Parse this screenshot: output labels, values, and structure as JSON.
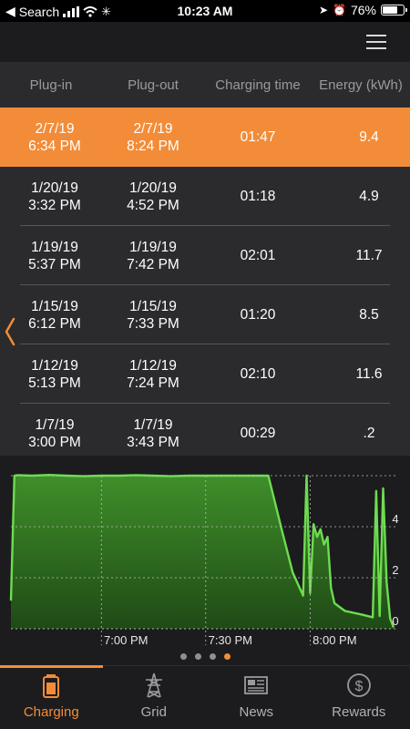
{
  "status_bar": {
    "carrier": "Search",
    "time": "10:23 AM",
    "battery": "76%",
    "battery_level": 0.76
  },
  "table": {
    "headers": [
      "Plug-in",
      "Plug-out",
      "Charging time",
      "Energy (kWh)"
    ],
    "rows": [
      {
        "plug_in_date": "2/7/19",
        "plug_in_time": "6:34 PM",
        "plug_out_date": "2/7/19",
        "plug_out_time": "8:24 PM",
        "charging_time": "01:47",
        "energy": "9.4",
        "selected": true
      },
      {
        "plug_in_date": "1/20/19",
        "plug_in_time": "3:32 PM",
        "plug_out_date": "1/20/19",
        "plug_out_time": "4:52 PM",
        "charging_time": "01:18",
        "energy": "4.9"
      },
      {
        "plug_in_date": "1/19/19",
        "plug_in_time": "5:37 PM",
        "plug_out_date": "1/19/19",
        "plug_out_time": "7:42 PM",
        "charging_time": "02:01",
        "energy": "11.7"
      },
      {
        "plug_in_date": "1/15/19",
        "plug_in_time": "6:12 PM",
        "plug_out_date": "1/15/19",
        "plug_out_time": "7:33 PM",
        "charging_time": "01:20",
        "energy": "8.5"
      },
      {
        "plug_in_date": "1/12/19",
        "plug_in_time": "5:13 PM",
        "plug_out_date": "1/12/19",
        "plug_out_time": "7:24 PM",
        "charging_time": "02:10",
        "energy": "11.6"
      },
      {
        "plug_in_date": "1/7/19",
        "plug_in_time": "3:00 PM",
        "plug_out_date": "1/7/19",
        "plug_out_time": "3:43 PM",
        "charging_time": "00:29",
        "energy": ".2"
      }
    ]
  },
  "chart_data": {
    "type": "area",
    "title": "",
    "xlabel": "",
    "ylabel": "",
    "x_ticks": [
      "7:00 PM",
      "7:30 PM",
      "8:00 PM"
    ],
    "y_ticks": [
      "0",
      "2",
      "4"
    ],
    "ylim": [
      0,
      6
    ],
    "grid": true,
    "color": "#6ddc4f",
    "series": [
      {
        "x": [
          "6:34 PM",
          "6:35 PM",
          "6:36 PM",
          "6:40 PM",
          "6:45 PM",
          "6:50 PM",
          "6:55 PM",
          "7:00 PM",
          "7:05 PM",
          "7:10 PM",
          "7:15 PM",
          "7:20 PM",
          "7:25 PM",
          "7:30 PM",
          "7:35 PM",
          "7:40 PM",
          "7:45 PM",
          "7:48 PM",
          "7:52 PM",
          "7:55 PM",
          "7:57 PM",
          "7:58 PM",
          "7:59 PM",
          "8:00 PM",
          "8:01 PM",
          "8:02 PM",
          "8:03 PM",
          "8:04 PM",
          "8:05 PM",
          "8:06 PM",
          "8:07 PM",
          "8:10 PM",
          "8:15 PM",
          "8:18 PM",
          "8:19 PM",
          "8:20 PM",
          "8:21 PM",
          "8:22 PM",
          "8:23 PM",
          "8:24 PM"
        ],
        "y": [
          1.1,
          6.0,
          6.02,
          6.0,
          6.03,
          6.0,
          5.98,
          6.0,
          6.0,
          6.02,
          6.0,
          5.98,
          6.0,
          6.0,
          6.0,
          6.0,
          6.0,
          6.0,
          3.8,
          2.2,
          1.6,
          1.3,
          6.0,
          1.4,
          4.1,
          3.6,
          3.9,
          3.3,
          3.6,
          1.6,
          1.0,
          0.7,
          0.55,
          0.45,
          5.4,
          0.5,
          5.5,
          1.8,
          0.4,
          0.05
        ]
      }
    ]
  },
  "pager": {
    "count": 4,
    "active": 3
  },
  "tabs": [
    {
      "label": "Charging",
      "icon": "battery-icon",
      "active": true
    },
    {
      "label": "Grid",
      "icon": "power-tower-icon"
    },
    {
      "label": "News",
      "icon": "newspaper-icon"
    },
    {
      "label": "Rewards",
      "icon": "dollar-icon"
    }
  ],
  "colors": {
    "accent": "#f28c38",
    "chart_line": "#6ddc4f",
    "background": "#1c1c1e",
    "panel": "#2b2b2d"
  }
}
